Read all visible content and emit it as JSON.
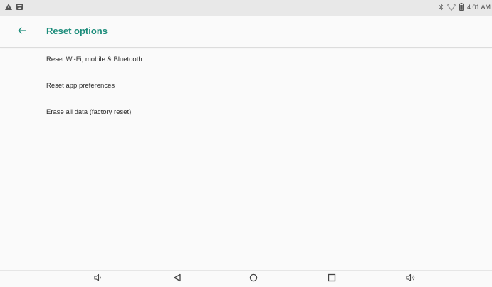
{
  "status_bar": {
    "time": "4:01 AM",
    "left_icons": [
      "warning-icon",
      "image-notification-icon"
    ],
    "right_icons": [
      "bluetooth-icon",
      "wifi-icon",
      "battery-icon"
    ]
  },
  "app_bar": {
    "back_icon": "arrow-left-icon",
    "title": "Reset options",
    "accent_color": "#1b8c7a"
  },
  "options": [
    {
      "label": "Reset Wi-Fi, mobile & Bluetooth"
    },
    {
      "label": "Reset app preferences"
    },
    {
      "label": "Erase all data (factory reset)"
    }
  ],
  "nav_bar": {
    "buttons": [
      "volume-down-icon",
      "back-icon",
      "home-icon",
      "recents-icon",
      "volume-up-icon"
    ]
  }
}
